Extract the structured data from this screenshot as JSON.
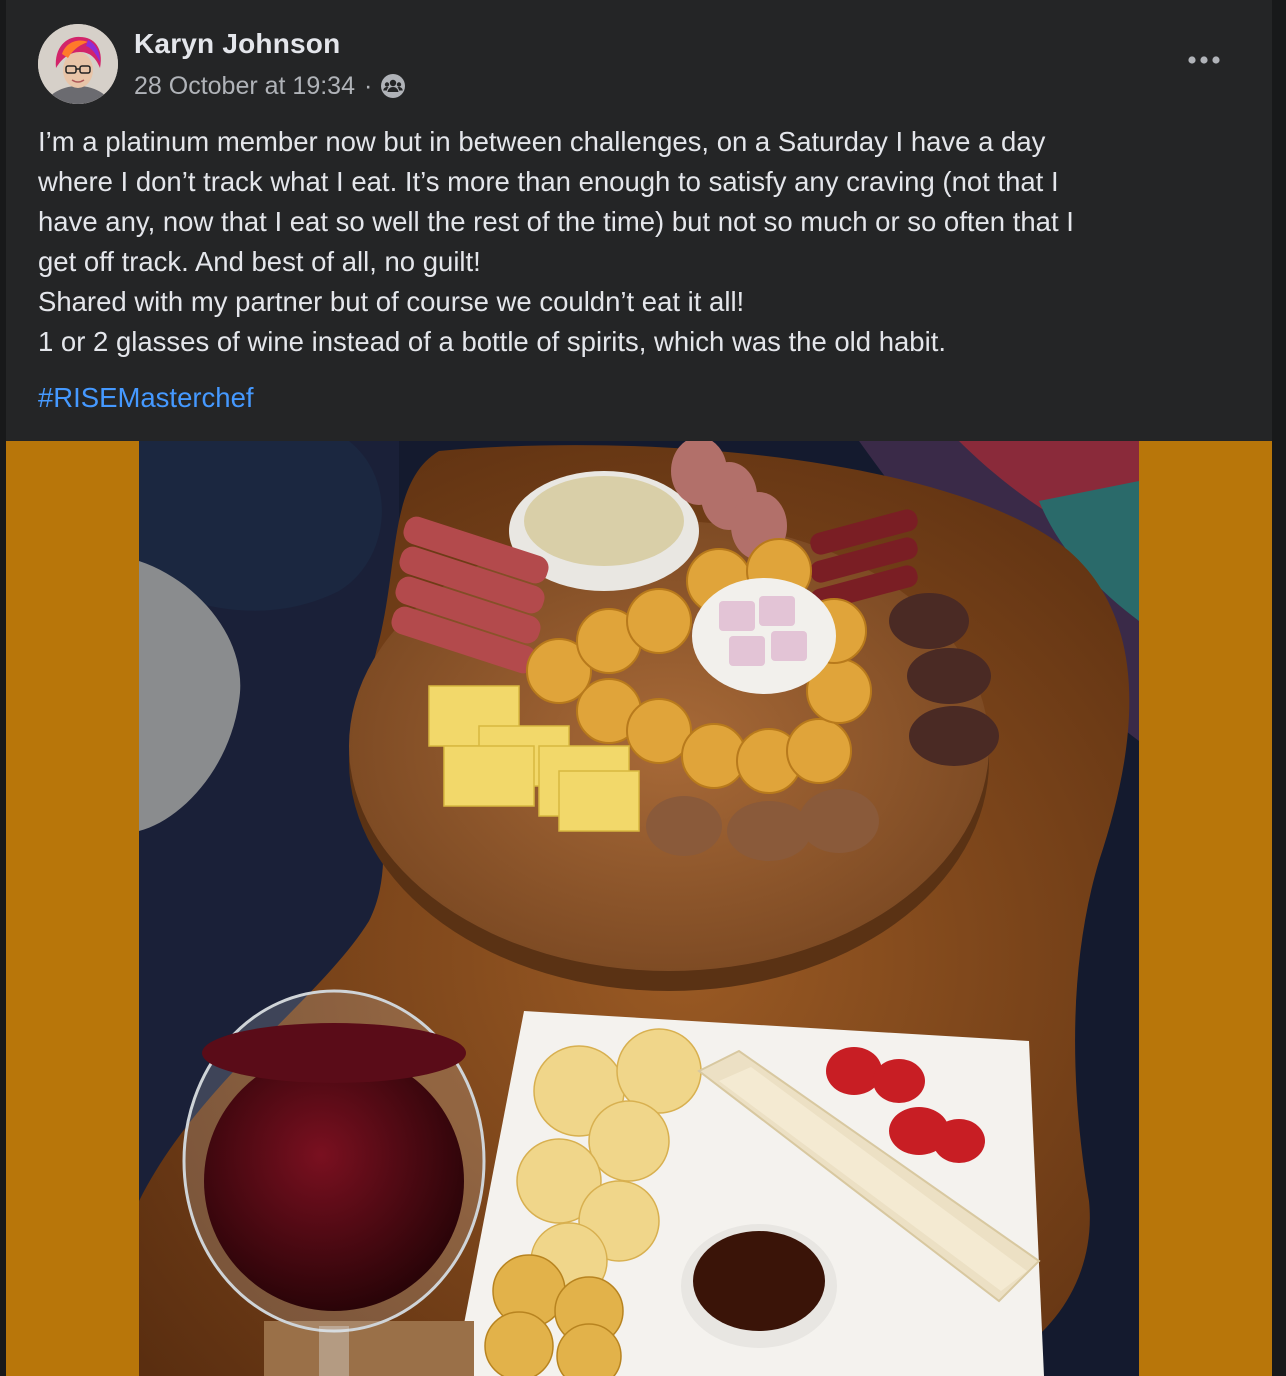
{
  "post": {
    "author": {
      "name": "Karyn Johnson"
    },
    "timestamp": "28 October at 19:34",
    "separator": "·",
    "audience_icon": "group-icon",
    "more_icon": "more-options-icon",
    "body_lines": [
      "I’m a platinum member now but in between challenges, on a Saturday I have a day",
      "where I don’t track what I eat. It’s more than enough to satisfy any craving (not that I",
      "have any, now that I eat so well the rest of the time) but not so much or so often that I",
      "get off track. And best of all, no guilt!",
      "Shared with my partner but of course we couldn’t eat it all!",
      "1 or 2 glasses of wine instead of a bottle of spirits, which was the old habit."
    ],
    "hashtag": "#RISEMasterchef"
  },
  "colors": {
    "card_background": "#242526",
    "primary_text": "#e4e6eb",
    "secondary_text": "#b0b3b8",
    "link": "#4599ff",
    "photo_letterbox": "#b8760a"
  }
}
